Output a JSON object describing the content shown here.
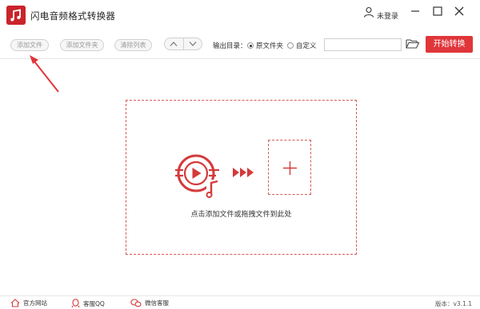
{
  "app": {
    "title": "闪电音频格式转换器",
    "brand_color": "#c9242b"
  },
  "titlebar": {
    "login_label": "未登录",
    "icons": [
      "user-icon",
      "minimize-icon",
      "maximize-icon",
      "close-icon"
    ]
  },
  "toolbar": {
    "add_file_label": "添加文件",
    "add_folder_label": "添加文件夹",
    "clear_list_label": "清除列表",
    "output_dir_label": "输出目录：",
    "option_original": "原文件夹",
    "option_custom": "自定义",
    "selected_option": "原文件夹",
    "path_value": "",
    "start_label": "开始转换",
    "accent_color": "#e0363a"
  },
  "main": {
    "drop_hint": "点击添加文件或拖拽文件到此处",
    "dash_color": "#d45a5a"
  },
  "footer": {
    "website_label": "官方网站",
    "qq_label": "客服QQ",
    "wechat_label": "微信客服",
    "version_label": "版本：v3.1.1"
  }
}
